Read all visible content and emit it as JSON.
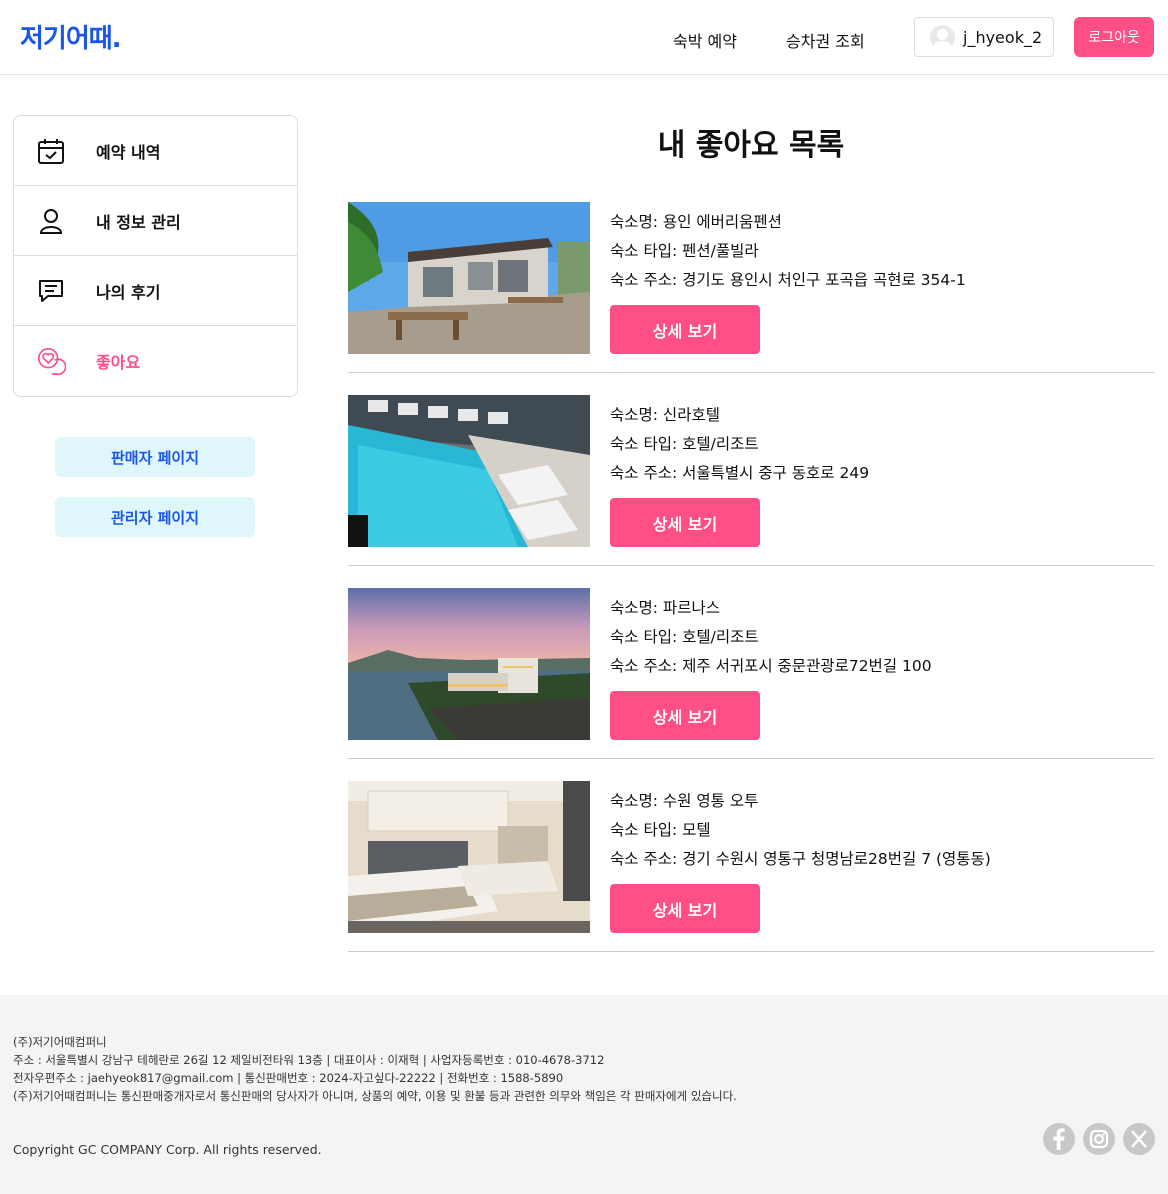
{
  "header": {
    "logo": "저기어때.",
    "nav": [
      "숙박 예약",
      "승차권 조회"
    ],
    "username": "j_hyeok_2",
    "logout_label": "로그아웃"
  },
  "sidebar": {
    "items": [
      {
        "label": "예약 내역",
        "icon": "calendar-check-icon"
      },
      {
        "label": "내 정보 관리",
        "icon": "user-icon"
      },
      {
        "label": "나의 후기",
        "icon": "chat-icon"
      },
      {
        "label": "좋아요",
        "icon": "heart-chat-icon",
        "active": true
      }
    ],
    "seller_page": "판매자 페이지",
    "admin_page": "관리자 페이지"
  },
  "main": {
    "title": "내 좋아요 목록",
    "detail_label": "상세 보기",
    "items": [
      {
        "name_line": "숙소명: 용인 에버리움펜션",
        "type_line": "숙소 타입: 펜션/풀빌라",
        "addr_line": "숙소 주소: 경기도 용인시 처인구 포곡읍 곡현로 354-1"
      },
      {
        "name_line": "숙소명: 신라호텔",
        "type_line": "숙소 타입: 호텔/리조트",
        "addr_line": "숙소 주소: 서울특별시 중구 동호로 249"
      },
      {
        "name_line": "숙소명: 파르나스",
        "type_line": "숙소 타입: 호텔/리조트",
        "addr_line": "숙소 주소: 제주 서귀포시 중문관광로72번길 100"
      },
      {
        "name_line": "숙소명: 수원 영통 오투",
        "type_line": "숙소 타입: 모텔",
        "addr_line": "숙소 주소: 경기 수원시 영통구 청명남로28번길 7 (영통동)"
      }
    ]
  },
  "footer": {
    "lines": [
      "(주)저기어때컴퍼니",
      "주소 : 서울특별시 강남구 테헤란로 26길 12 제일비전타워 13층 | 대표이사 : 이재혁 | 사업자등록번호 : 010-4678-3712",
      "전자우편주소 : jaehyeok817@gmail.com | 통신판매번호 : 2024-자고싶다-22222 | 전화번호 : 1588-5890",
      "(주)저기어때컴퍼니는 통신판매중개자로서 통신판매의 당사자가 아니며, 상품의 예약, 이용 및 환불 등과 관련한 의무와 책임은 각 판매자에게 있습니다."
    ],
    "copyright": "Copyright GC COMPANY Corp. All rights reserved.",
    "social": [
      "facebook-icon",
      "instagram-icon",
      "x-icon"
    ]
  },
  "colors": {
    "brand": "#1a57e8",
    "accent": "#ff4f86",
    "sub_button_bg": "#dff6fb"
  }
}
